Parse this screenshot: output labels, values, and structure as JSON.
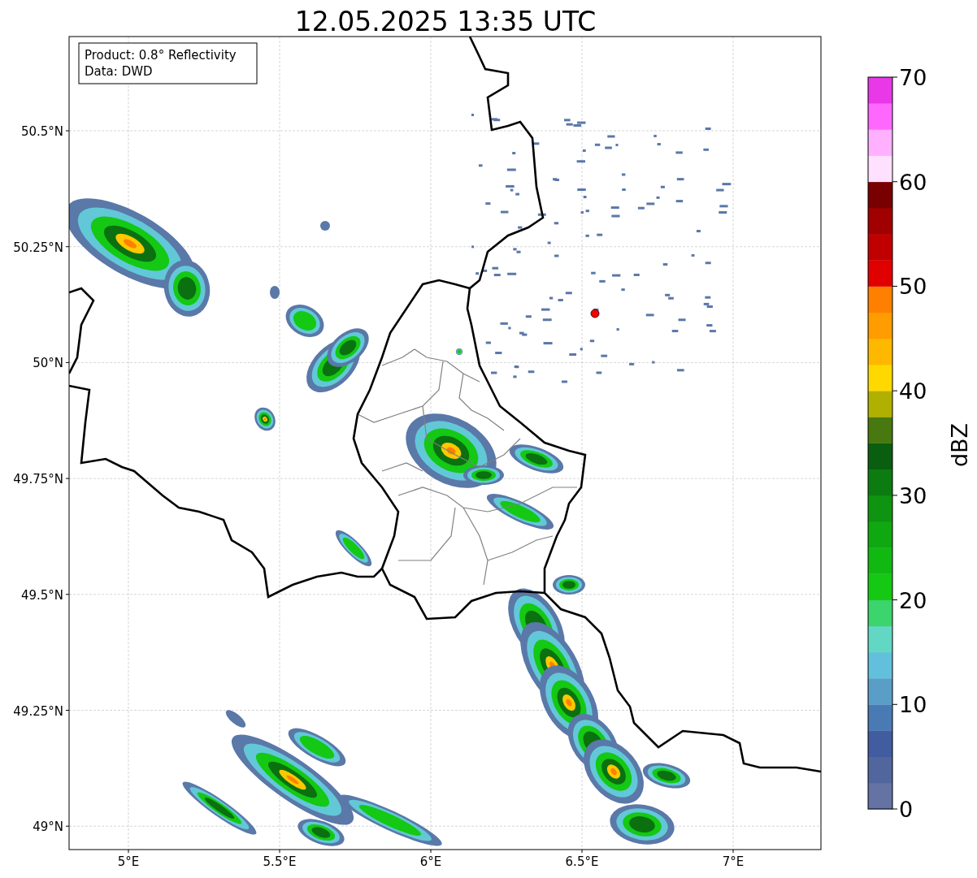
{
  "title": "12.05.2025 13:35 UTC",
  "info_box": {
    "lines": [
      "Product: 0.8° Reflectivity",
      "Data: DWD"
    ]
  },
  "map": {
    "x_tick_labels": [
      "5°E",
      "5.5°E",
      "6°E",
      "6.5°E",
      "7°E"
    ],
    "y_tick_labels": [
      "50.5°N",
      "50.25°N",
      "50°N",
      "49.75°N",
      "49.5°N",
      "49.25°N",
      "49°N"
    ]
  },
  "colorbar": {
    "label": "dBZ",
    "tick_labels": [
      "70",
      "60",
      "50",
      "40",
      "30",
      "20",
      "10",
      "0"
    ],
    "segments": [
      {
        "color": "#6472a4"
      },
      {
        "color": "#52669e"
      },
      {
        "color": "#425ca0"
      },
      {
        "color": "#4a7ab4"
      },
      {
        "color": "#5a9ec8"
      },
      {
        "color": "#62c0dc"
      },
      {
        "color": "#62d8c4"
      },
      {
        "color": "#3cd46c"
      },
      {
        "color": "#14c814"
      },
      {
        "color": "#12b812"
      },
      {
        "color": "#10a810"
      },
      {
        "color": "#0e9410"
      },
      {
        "color": "#0c7c10"
      },
      {
        "color": "#0a5e10"
      },
      {
        "color": "#487810"
      },
      {
        "color": "#b0b000"
      },
      {
        "color": "#ffd800"
      },
      {
        "color": "#ffb800"
      },
      {
        "color": "#ff9c00"
      },
      {
        "color": "#ff8000"
      },
      {
        "color": "#e00000"
      },
      {
        "color": "#c00000"
      },
      {
        "color": "#a00000"
      },
      {
        "color": "#780000"
      },
      {
        "color": "#ffe0ff"
      },
      {
        "color": "#ffb0ff"
      },
      {
        "color": "#ff68ff"
      },
      {
        "color": "#e838e8"
      }
    ]
  }
}
